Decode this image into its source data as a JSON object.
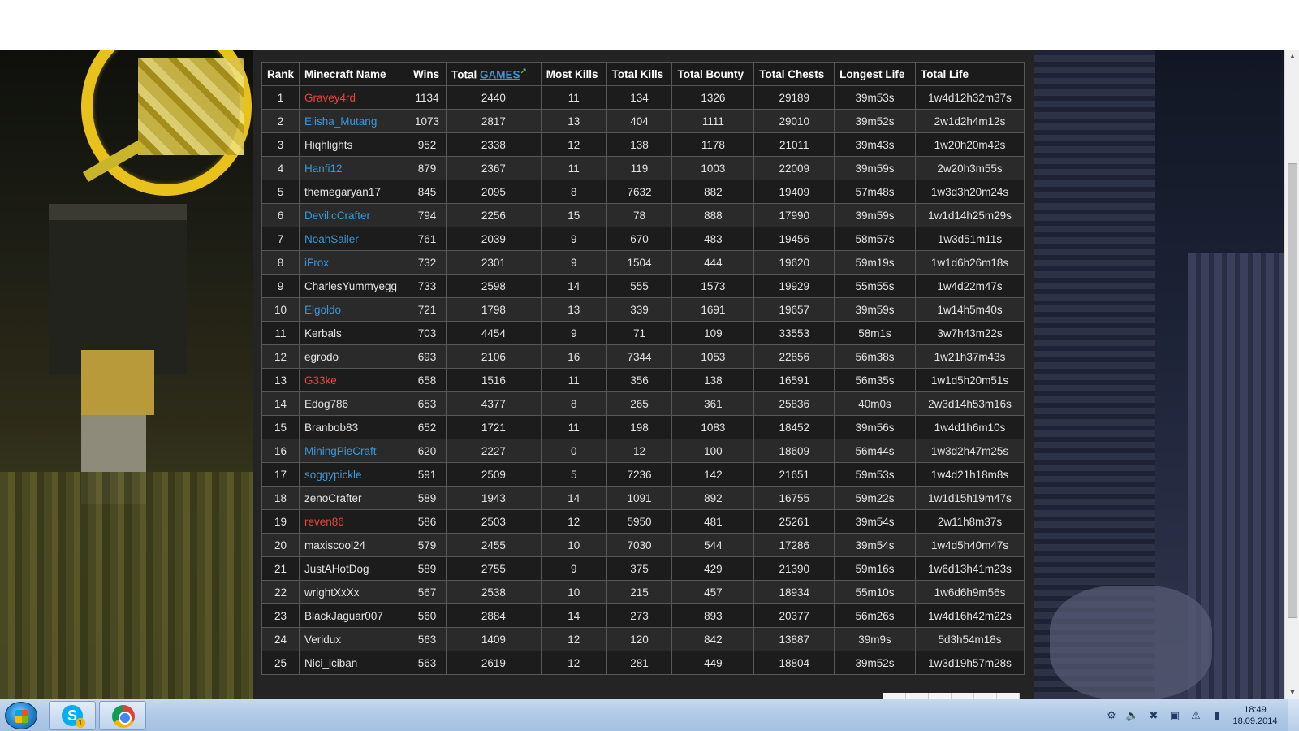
{
  "colors": {
    "name_red": "#e8453c",
    "name_blue": "#3a97d8",
    "table_bg": "#242424",
    "border": "#575757",
    "taskbar": "#b0c9e6"
  },
  "table": {
    "headers": {
      "rank": "Rank",
      "name": "Minecraft Name",
      "wins": "Wins",
      "total_games_prefix": "Total",
      "total_games_link": "GAMES",
      "most_kills": "Most Kills",
      "total_kills": "Total Kills",
      "total_bounty": "Total Bounty",
      "total_chests": "Total Chests",
      "longest_life": "Longest Life",
      "total_life": "Total Life"
    },
    "rows": [
      {
        "rank": "1",
        "name": "Gravey4rd",
        "color": "red",
        "wins": "1134",
        "games": "2440",
        "most_kills": "11",
        "kills": "134",
        "bounty": "1326",
        "chests": "29189",
        "longest": "39m53s",
        "total_life": "1w4d12h32m37s"
      },
      {
        "rank": "2",
        "name": "Elisha_Mutang",
        "color": "blue",
        "wins": "1073",
        "games": "2817",
        "most_kills": "13",
        "kills": "404",
        "bounty": "1111",
        "chests": "29010",
        "longest": "39m52s",
        "total_life": "2w1d2h4m12s"
      },
      {
        "rank": "3",
        "name": "Hiqhlights",
        "color": "plain",
        "wins": "952",
        "games": "2338",
        "most_kills": "12",
        "kills": "138",
        "bounty": "1178",
        "chests": "21011",
        "longest": "39m43s",
        "total_life": "1w20h20m42s"
      },
      {
        "rank": "4",
        "name": "Hanfi12",
        "color": "blue",
        "wins": "879",
        "games": "2367",
        "most_kills": "11",
        "kills": "119",
        "bounty": "1003",
        "chests": "22009",
        "longest": "39m59s",
        "total_life": "2w20h3m55s"
      },
      {
        "rank": "5",
        "name": "themegaryan17",
        "color": "plain",
        "wins": "845",
        "games": "2095",
        "most_kills": "8",
        "kills": "7632",
        "bounty": "882",
        "chests": "19409",
        "longest": "57m48s",
        "total_life": "1w3d3h20m24s"
      },
      {
        "rank": "6",
        "name": "DevilicCrafter",
        "color": "blue",
        "wins": "794",
        "games": "2256",
        "most_kills": "15",
        "kills": "78",
        "bounty": "888",
        "chests": "17990",
        "longest": "39m59s",
        "total_life": "1w1d14h25m29s"
      },
      {
        "rank": "7",
        "name": "NoahSailer",
        "color": "blue",
        "wins": "761",
        "games": "2039",
        "most_kills": "9",
        "kills": "670",
        "bounty": "483",
        "chests": "19456",
        "longest": "58m57s",
        "total_life": "1w3d51m11s"
      },
      {
        "rank": "8",
        "name": "iFrox",
        "color": "blue",
        "wins": "732",
        "games": "2301",
        "most_kills": "9",
        "kills": "1504",
        "bounty": "444",
        "chests": "19620",
        "longest": "59m19s",
        "total_life": "1w1d6h26m18s"
      },
      {
        "rank": "9",
        "name": "CharlesYummyegg",
        "color": "plain",
        "wins": "733",
        "games": "2598",
        "most_kills": "14",
        "kills": "555",
        "bounty": "1573",
        "chests": "19929",
        "longest": "55m55s",
        "total_life": "1w4d22m47s"
      },
      {
        "rank": "10",
        "name": "Elgoldo",
        "color": "blue",
        "wins": "721",
        "games": "1798",
        "most_kills": "13",
        "kills": "339",
        "bounty": "1691",
        "chests": "19657",
        "longest": "39m59s",
        "total_life": "1w14h5m40s"
      },
      {
        "rank": "11",
        "name": "Kerbals",
        "color": "plain",
        "wins": "703",
        "games": "4454",
        "most_kills": "9",
        "kills": "71",
        "bounty": "109",
        "chests": "33553",
        "longest": "58m1s",
        "total_life": "3w7h43m22s"
      },
      {
        "rank": "12",
        "name": "egrodo",
        "color": "plain",
        "wins": "693",
        "games": "2106",
        "most_kills": "16",
        "kills": "7344",
        "bounty": "1053",
        "chests": "22856",
        "longest": "56m38s",
        "total_life": "1w21h37m43s"
      },
      {
        "rank": "13",
        "name": "G33ke",
        "color": "red",
        "wins": "658",
        "games": "1516",
        "most_kills": "11",
        "kills": "356",
        "bounty": "138",
        "chests": "16591",
        "longest": "56m35s",
        "total_life": "1w1d5h20m51s"
      },
      {
        "rank": "14",
        "name": "Edog786",
        "color": "plain",
        "wins": "653",
        "games": "4377",
        "most_kills": "8",
        "kills": "265",
        "bounty": "361",
        "chests": "25836",
        "longest": "40m0s",
        "total_life": "2w3d14h53m16s"
      },
      {
        "rank": "15",
        "name": "Branbob83",
        "color": "plain",
        "wins": "652",
        "games": "1721",
        "most_kills": "11",
        "kills": "198",
        "bounty": "1083",
        "chests": "18452",
        "longest": "39m56s",
        "total_life": "1w4d1h6m10s"
      },
      {
        "rank": "16",
        "name": "MiningPieCraft",
        "color": "blue",
        "wins": "620",
        "games": "2227",
        "most_kills": "0",
        "kills": "12",
        "bounty": "100",
        "chests": "18609",
        "longest": "56m44s",
        "total_life": "1w3d2h47m25s"
      },
      {
        "rank": "17",
        "name": "soggypickle",
        "color": "blue",
        "wins": "591",
        "games": "2509",
        "most_kills": "5",
        "kills": "7236",
        "bounty": "142",
        "chests": "21651",
        "longest": "59m53s",
        "total_life": "1w4d21h18m8s"
      },
      {
        "rank": "18",
        "name": "zenoCrafter",
        "color": "plain",
        "wins": "589",
        "games": "1943",
        "most_kills": "14",
        "kills": "1091",
        "bounty": "892",
        "chests": "16755",
        "longest": "59m22s",
        "total_life": "1w1d15h19m47s"
      },
      {
        "rank": "19",
        "name": "reven86",
        "color": "red",
        "wins": "586",
        "games": "2503",
        "most_kills": "12",
        "kills": "5950",
        "bounty": "481",
        "chests": "25261",
        "longest": "39m54s",
        "total_life": "2w11h8m37s"
      },
      {
        "rank": "20",
        "name": "maxiscool24",
        "color": "plain",
        "wins": "579",
        "games": "2455",
        "most_kills": "10",
        "kills": "7030",
        "bounty": "544",
        "chests": "17286",
        "longest": "39m54s",
        "total_life": "1w4d5h40m47s"
      },
      {
        "rank": "21",
        "name": "JustAHotDog",
        "color": "plain",
        "wins": "589",
        "games": "2755",
        "most_kills": "9",
        "kills": "375",
        "bounty": "429",
        "chests": "21390",
        "longest": "59m16s",
        "total_life": "1w6d13h41m23s"
      },
      {
        "rank": "22",
        "name": "wrightXxXx",
        "color": "plain",
        "wins": "567",
        "games": "2538",
        "most_kills": "10",
        "kills": "215",
        "bounty": "457",
        "chests": "18934",
        "longest": "55m10s",
        "total_life": "1w6d6h9m56s"
      },
      {
        "rank": "23",
        "name": "BlackJaguar007",
        "color": "plain",
        "wins": "560",
        "games": "2884",
        "most_kills": "14",
        "kills": "273",
        "bounty": "893",
        "chests": "20377",
        "longest": "56m26s",
        "total_life": "1w4d16h42m22s"
      },
      {
        "rank": "24",
        "name": "Veridux",
        "color": "plain",
        "wins": "563",
        "games": "1409",
        "most_kills": "12",
        "kills": "120",
        "bounty": "842",
        "chests": "13887",
        "longest": "39m9s",
        "total_life": "5d3h54m18s"
      },
      {
        "rank": "25",
        "name": "Nici_iciban",
        "color": "plain",
        "wins": "563",
        "games": "2619",
        "most_kills": "12",
        "kills": "281",
        "bounty": "449",
        "chests": "18804",
        "longest": "39m52s",
        "total_life": "1w3d19h57m28s"
      }
    ]
  },
  "icons": {
    "external_link": "external-link-icon",
    "start": "windows-start-icon",
    "skype": "skype-icon",
    "chrome": "chrome-icon"
  },
  "taskbar": {
    "skype_badge": "1",
    "time": "18:49",
    "date": "18.09.2014"
  }
}
